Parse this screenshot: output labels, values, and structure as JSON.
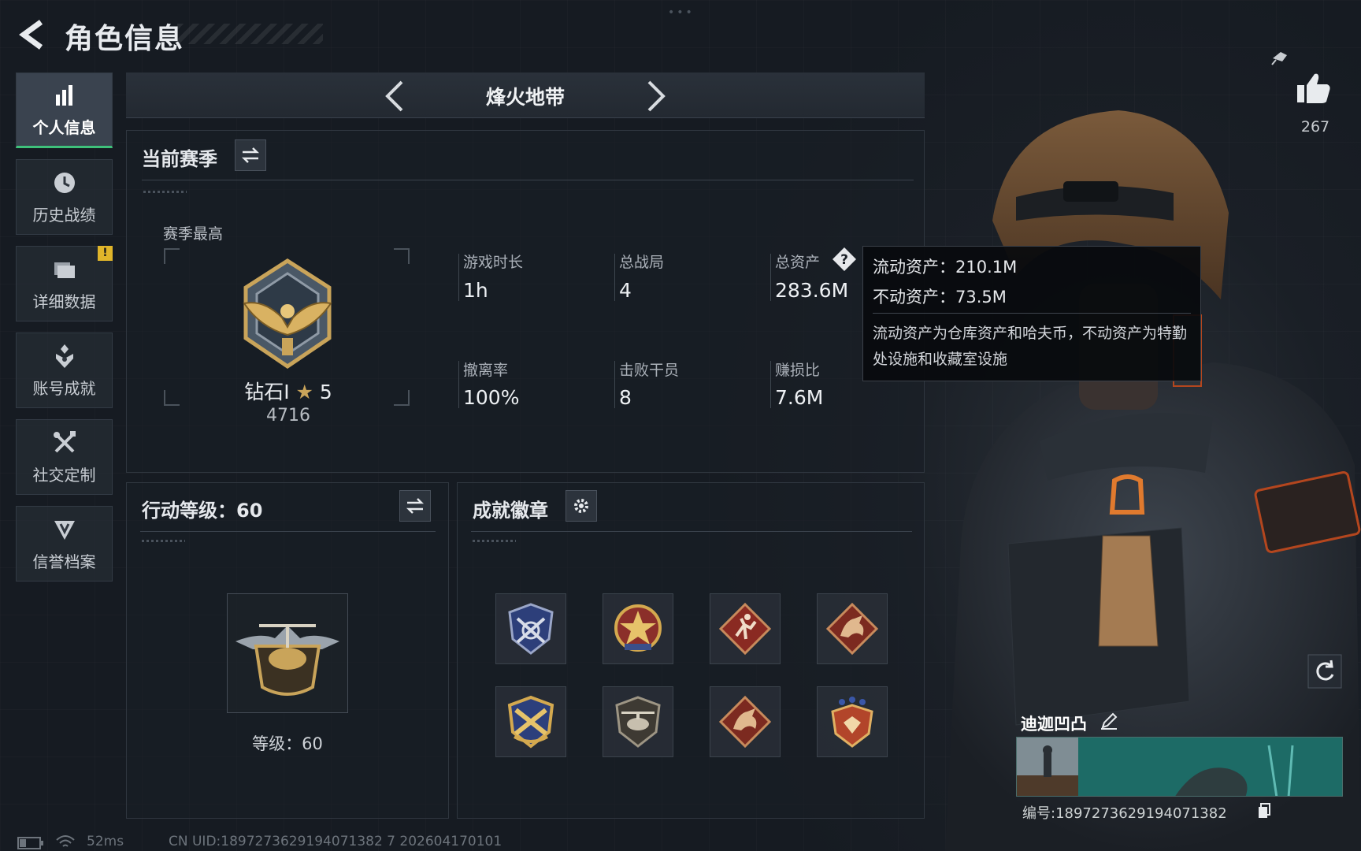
{
  "header": {
    "title": "角色信息"
  },
  "sidebar": {
    "items": [
      {
        "label": "个人信息",
        "icon": "bar-chart-icon",
        "active": true
      },
      {
        "label": "历史战绩",
        "icon": "history-clock-icon"
      },
      {
        "label": "详细数据",
        "icon": "folder-icon",
        "badge": "!"
      },
      {
        "label": "账号成就",
        "icon": "achievement-medal-icon"
      },
      {
        "label": "社交定制",
        "icon": "tools-icon"
      },
      {
        "label": "信誉档案",
        "icon": "shield-badge-icon"
      }
    ]
  },
  "mode": {
    "title": "烽火地带"
  },
  "season": {
    "title": "当前赛季",
    "best_label": "赛季最高",
    "rank_name": "钻石Ⅰ",
    "rank_stars": "5",
    "rank_score": "4716",
    "stats": [
      {
        "label": "游戏时长",
        "value": "1h"
      },
      {
        "label": "总战局",
        "value": "4"
      },
      {
        "label": "总资产",
        "value": "283.6M"
      },
      {
        "label": "撤离率",
        "value": "100%"
      },
      {
        "label": "击败干员",
        "value": "8"
      },
      {
        "label": "赚损比",
        "value": "7.6M"
      }
    ]
  },
  "tooltip": {
    "liquid": "流动资产：210.1M",
    "fixed": "不动资产：73.5M",
    "description": "流动资产为仓库资产和哈夫币，不动资产为特勤处设施和收藏室设施"
  },
  "action_level": {
    "title": "行动等级：60",
    "level_text": "等级：60"
  },
  "achievements": {
    "title": "成就徽章",
    "badges": [
      {
        "icon": "crossed-rifles-shield-icon"
      },
      {
        "icon": "star-emblem-icon"
      },
      {
        "icon": "runner-diamond-icon"
      },
      {
        "icon": "dragon-diamond-icon"
      },
      {
        "icon": "crossed-missiles-shield-icon"
      },
      {
        "icon": "helicopter-shield-icon"
      },
      {
        "icon": "dragon-diamond-icon"
      },
      {
        "icon": "stars-crest-icon"
      }
    ]
  },
  "profile": {
    "likes": "267",
    "name": "迪迦凹凸",
    "player_id": "编号:1897273629194071382"
  },
  "footer": {
    "ping": "52ms",
    "uid": "CN UID:1897273629194071382 7 202604170101"
  },
  "colors": {
    "accent_green": "#3ec17a",
    "badge_yellow": "#e0b52a",
    "gold": "#c9a45a"
  }
}
